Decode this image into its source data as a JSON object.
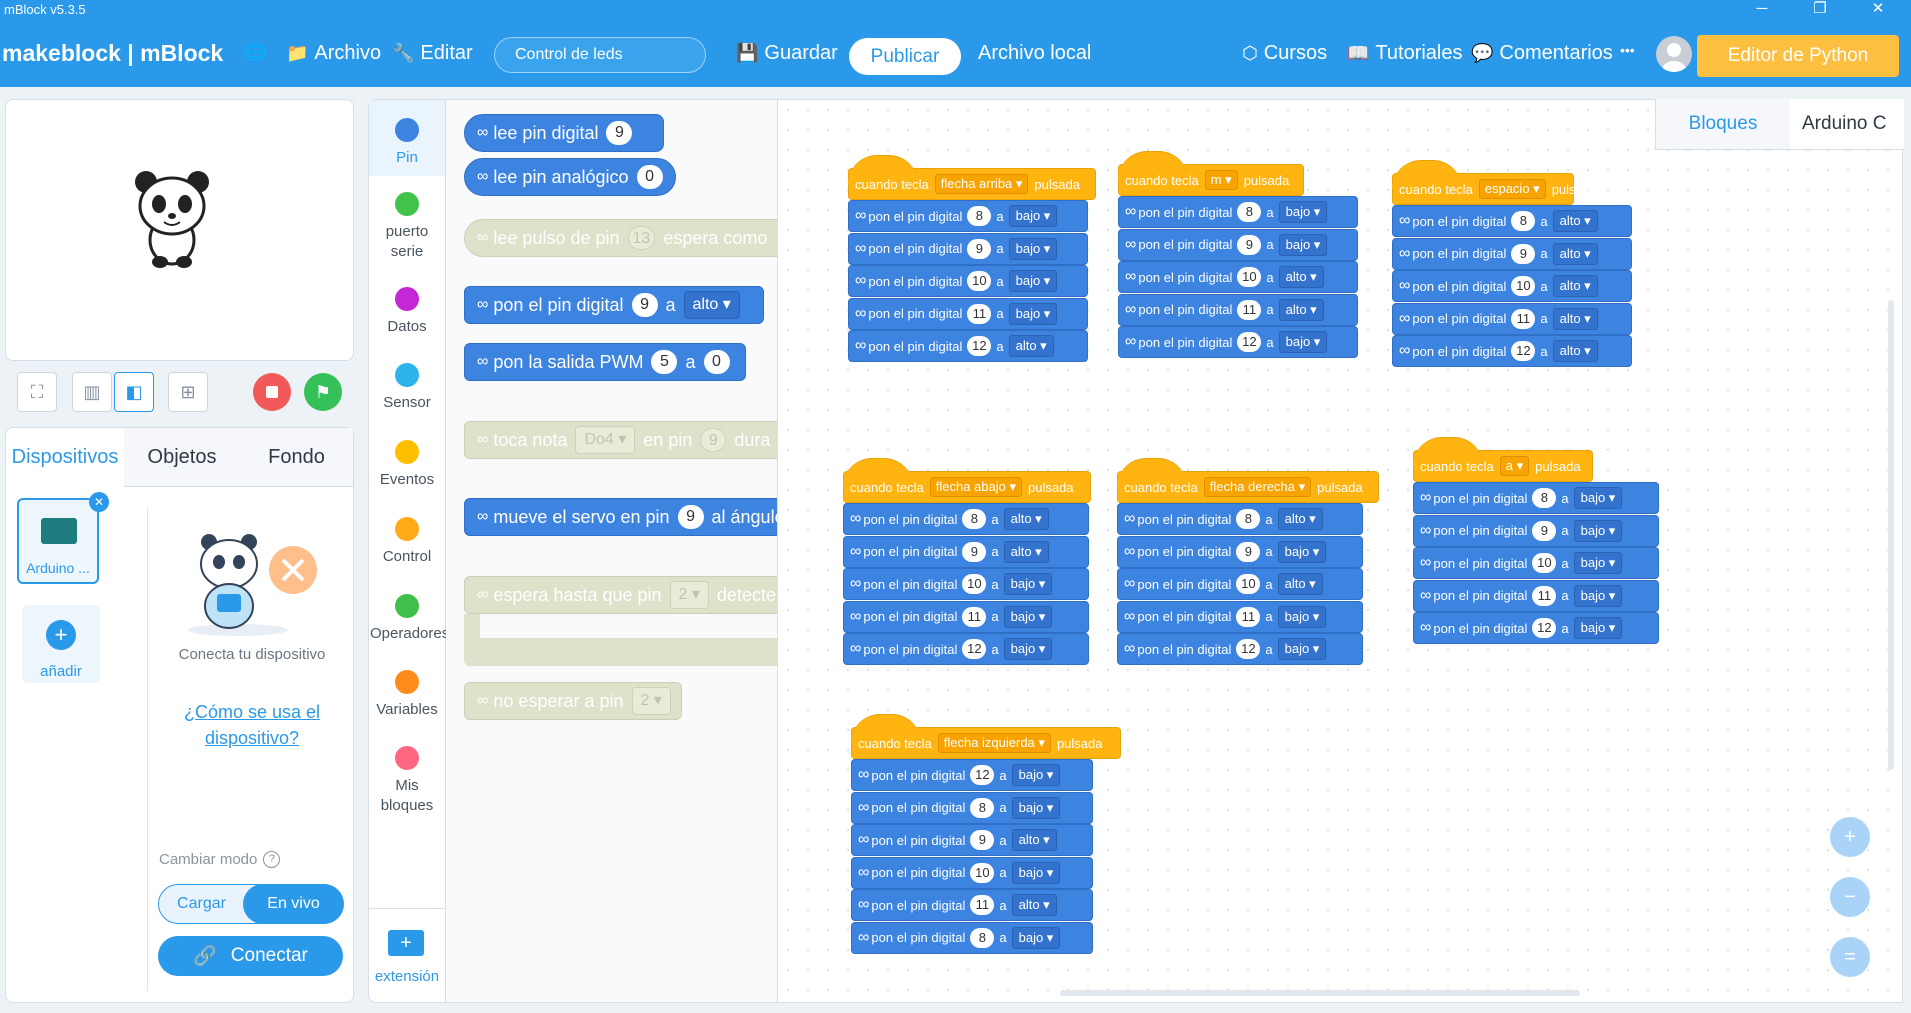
{
  "titlebar": {
    "title": "mBlock v5.3.5",
    "min": "─",
    "restore": "❐",
    "close": "✕"
  },
  "menu": {
    "brand": "makeblock | mBlock",
    "archivo": "Archivo",
    "editar": "Editar",
    "project_name": "Control de leds",
    "guardar": "Guardar",
    "publicar": "Publicar",
    "archivo_local": "Archivo local",
    "cursos": "Cursos",
    "tutoriales": "Tutoriales",
    "comentarios": "Comentarios",
    "more": "•••",
    "python_editor": "Editor de Python"
  },
  "left": {
    "tabs": [
      "Dispositivos",
      "Objetos",
      "Fondo"
    ],
    "device_name": "Arduino ...",
    "add_label": "añadir",
    "connect_text": "Conecta tu dispositivo",
    "help_link": "¿Cómo se usa el dispositivo?",
    "mode_label": "Cambiar modo",
    "mode_upload": "Cargar",
    "mode_live": "En vivo",
    "connect_button": "Conectar"
  },
  "categories": [
    {
      "label": "Pin",
      "color": "#3d84e0"
    },
    {
      "label": "puerto serie",
      "color": "#41c24a"
    },
    {
      "label": "Datos",
      "color": "#c526d6"
    },
    {
      "label": "Sensor",
      "color": "#2eb3ea"
    },
    {
      "label": "Eventos",
      "color": "#ffbf00"
    },
    {
      "label": "Control",
      "color": "#ffab19"
    },
    {
      "label": "Operadores",
      "color": "#40bf4a"
    },
    {
      "label": "Variables",
      "color": "#ff8c1a"
    },
    {
      "label": "Mis bloques",
      "color": "#ff6680"
    }
  ],
  "extension_label": "extensión",
  "palette": {
    "lee_pin_digital": "lee pin digital",
    "lee_pin_digital_val": "9",
    "lee_pin_analogico": "lee pin analógico",
    "lee_pin_analogico_val": "0",
    "lee_pulso": "lee pulso de pin",
    "lee_pulso_val": "13",
    "lee_pulso_rest": "espera como",
    "pon_pin": "pon el pin digital",
    "pon_pin_val": "9",
    "pon_pin_a": "a",
    "pon_pin_dd": "alto ▾",
    "pwm": "pon la salida PWM",
    "pwm_val": "5",
    "pwm_a": "a",
    "pwm_val2": "0",
    "nota": "toca nota",
    "nota_dd": "Do4 ▾",
    "nota_pin": "en pin",
    "nota_val": "9",
    "nota_rest": "dura",
    "servo": "mueve el servo en pin",
    "servo_val": "9",
    "servo_rest": "al ángulo",
    "espera": "espera hasta que pin",
    "espera_dd": "2 ▾",
    "espera_rest": "detecte",
    "no_esperar": "no esperar a pin",
    "no_esperar_dd": "2 ▾"
  },
  "canvas_tabs": {
    "bloques": "Bloques",
    "arduino": "Arduino C"
  },
  "scripts": [
    {
      "key": "flecha arriba ▾",
      "rows": [
        [
          "8",
          "bajo ▾"
        ],
        [
          "9",
          "bajo ▾"
        ],
        [
          "10",
          "bajo ▾"
        ],
        [
          "11",
          "bajo ▾"
        ],
        [
          "12",
          "alto ▾"
        ]
      ]
    },
    {
      "key": "m ▾",
      "rows": [
        [
          "8",
          "bajo ▾"
        ],
        [
          "9",
          "bajo ▾"
        ],
        [
          "10",
          "alto ▾"
        ],
        [
          "11",
          "alto ▾"
        ],
        [
          "12",
          "bajo ▾"
        ]
      ]
    },
    {
      "key": "espacio ▾",
      "rows": [
        [
          "8",
          "alto ▾"
        ],
        [
          "9",
          "alto ▾"
        ],
        [
          "10",
          "alto ▾"
        ],
        [
          "11",
          "alto ▾"
        ],
        [
          "12",
          "alto ▾"
        ]
      ]
    },
    {
      "key": "flecha abajo ▾",
      "rows": [
        [
          "8",
          "alto ▾"
        ],
        [
          "9",
          "alto ▾"
        ],
        [
          "10",
          "bajo ▾"
        ],
        [
          "11",
          "bajo ▾"
        ],
        [
          "12",
          "bajo ▾"
        ]
      ]
    },
    {
      "key": "flecha derecha ▾",
      "rows": [
        [
          "8",
          "alto ▾"
        ],
        [
          "9",
          "bajo ▾"
        ],
        [
          "10",
          "alto ▾"
        ],
        [
          "11",
          "bajo ▾"
        ],
        [
          "12",
          "bajo ▾"
        ]
      ]
    },
    {
      "key": "a ▾",
      "rows": [
        [
          "8",
          "bajo ▾"
        ],
        [
          "9",
          "bajo ▾"
        ],
        [
          "10",
          "bajo ▾"
        ],
        [
          "11",
          "bajo ▾"
        ],
        [
          "12",
          "bajo ▾"
        ]
      ]
    },
    {
      "key": "flecha izquierda ▾",
      "rows": [
        [
          "12",
          "bajo ▾"
        ],
        [
          "8",
          "bajo ▾"
        ],
        [
          "9",
          "alto ▾"
        ],
        [
          "10",
          "bajo ▾"
        ],
        [
          "11",
          "alto ▾"
        ],
        [
          "8",
          "bajo ▾"
        ]
      ]
    }
  ],
  "block_text": {
    "when": "cuando tecla",
    "pressed": "pulsada",
    "set_pin": "pon el pin digital",
    "to": "a"
  },
  "zoom": {
    "in": "+",
    "out": "−",
    "reset": "="
  }
}
